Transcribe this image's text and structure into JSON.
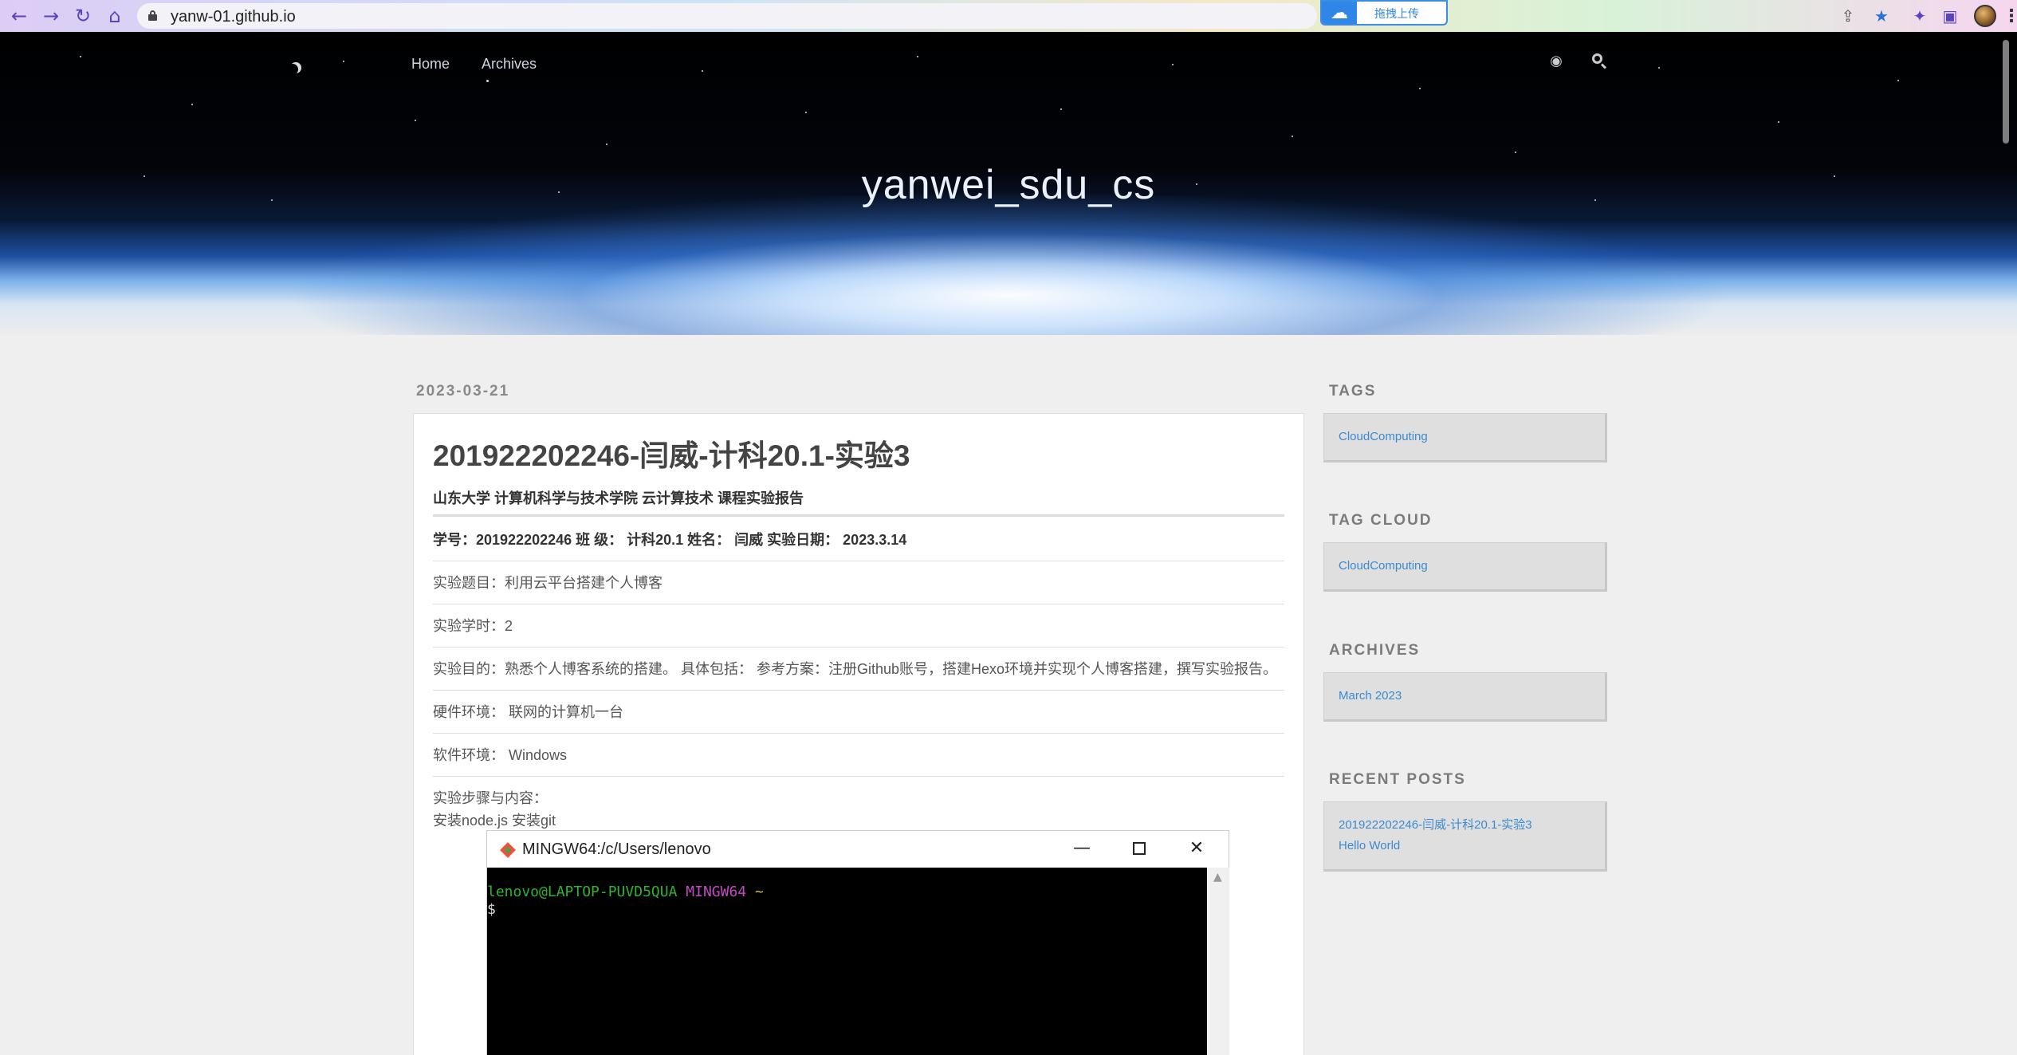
{
  "browser": {
    "url": "yanw-01.github.io",
    "upload_label": "拖拽上传",
    "colors": {
      "accent": "#5a43c0",
      "upload_blue": "#2f86e6"
    }
  },
  "site": {
    "nav": [
      "Home",
      "Archives"
    ],
    "title": "yanwei_sdu_cs"
  },
  "post": {
    "date": "2023-03-21",
    "title": "201922202246-闫威-计科20.1-实验3",
    "report_header": "山东大学 计算机科学与技术学院 云计算技术 课程实验报告",
    "student_line": "学号：201922202246 班 级： 计科20.1 姓名： 闫威 实验日期： 2023.3.14",
    "subject": "实验题目：利用云平台搭建个人博客",
    "hours": "实验学时：2",
    "purpose": "实验目的：熟悉个人博客系统的搭建。 具体包括： 参考方案：注册Github账号，搭建Hexo环境并实现个人博客搭建，撰写实验报告。",
    "hardware": "硬件环境： 联网的计算机一台",
    "software": "软件环境： Windows",
    "steps_label": "实验步骤与内容：",
    "steps_first": "安装node.js 安装git"
  },
  "terminal": {
    "title": "MINGW64:/c/Users/lenovo",
    "prompt_user": "lenovo@LAPTOP-PUVD5QUA",
    "prompt_env": "MINGW64",
    "prompt_dir": "~",
    "prompt_symbol": "$"
  },
  "sidebar": {
    "tags_heading": "TAGS",
    "tags": [
      "CloudComputing"
    ],
    "tag_cloud_heading": "TAG CLOUD",
    "tag_cloud": [
      "CloudComputing"
    ],
    "archives_heading": "ARCHIVES",
    "archives": [
      "March 2023"
    ],
    "recent_heading": "RECENT POSTS",
    "recent": [
      "201922202246-闫威-计科20.1-实验3",
      "Hello World"
    ]
  }
}
